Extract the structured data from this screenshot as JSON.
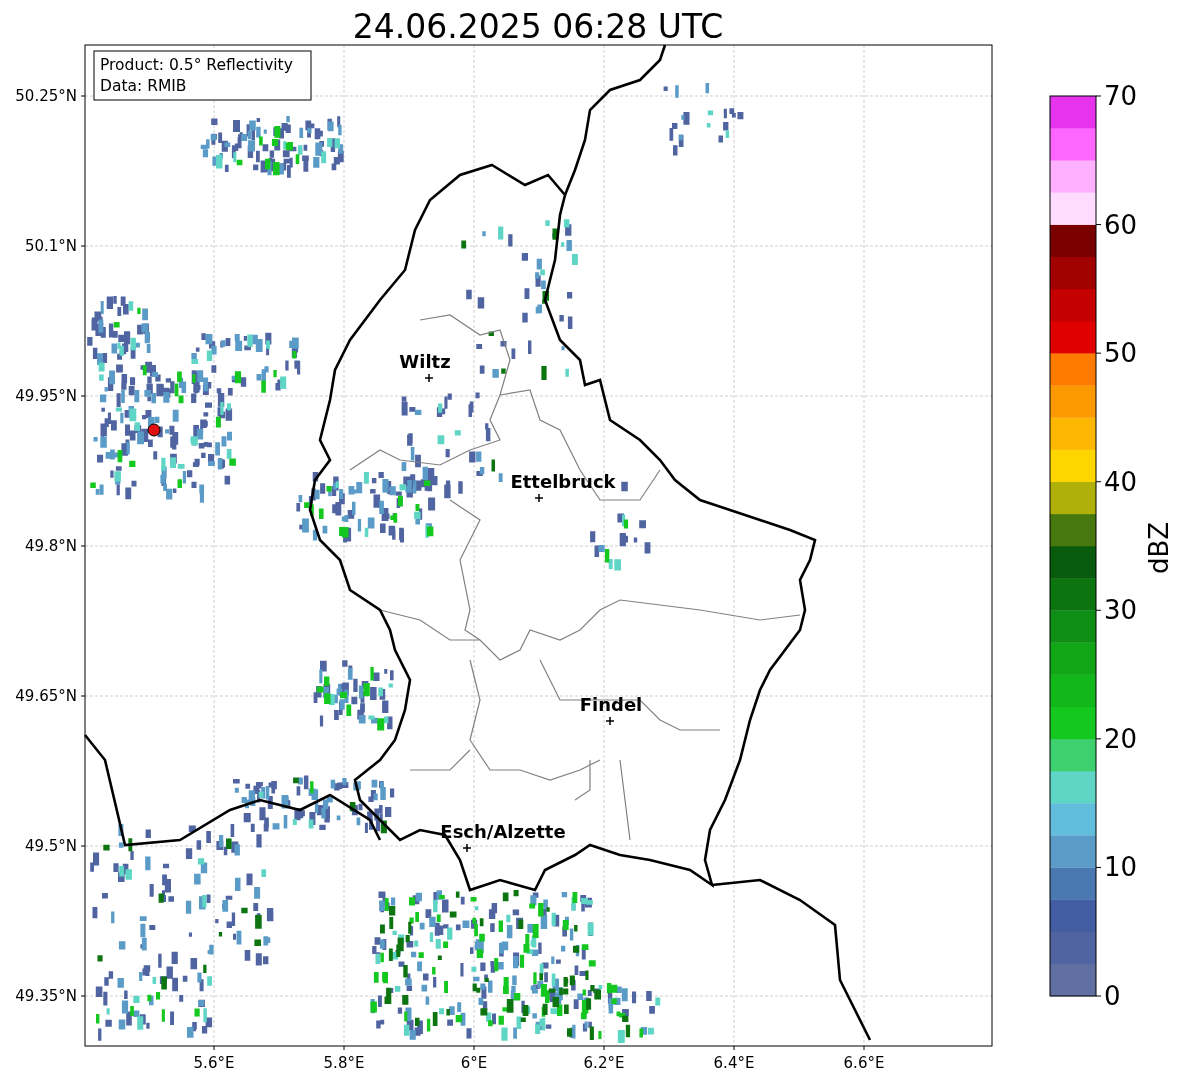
{
  "title": "24.06.2025 06:28 UTC",
  "info_box": {
    "lines": [
      "Product: 0.5° Reflectivity",
      "Data: RMIB"
    ]
  },
  "map": {
    "x_ticks": [
      "5.6°E",
      "5.8°E",
      "6°E",
      "6.2°E",
      "6.4°E",
      "6.6°E"
    ],
    "y_ticks": [
      "50.25°N",
      "50.1°N",
      "49.95°N",
      "49.8°N",
      "49.65°N",
      "49.5°N",
      "49.35°N"
    ],
    "cities": [
      {
        "name": "Wiltz"
      },
      {
        "name": "Ettelbruck"
      },
      {
        "name": "Findel"
      },
      {
        "name": "Esch/Alzette"
      }
    ]
  },
  "colorbar": {
    "label": "dBZ",
    "ticks": [
      "70",
      "60",
      "50",
      "40",
      "30",
      "20",
      "10",
      "0"
    ],
    "bins": [
      {
        "color": "#6070a2"
      },
      {
        "color": "#4f64a0"
      },
      {
        "color": "#435da3"
      },
      {
        "color": "#4a78b0"
      },
      {
        "color": "#5a9bc7"
      },
      {
        "color": "#62bcdc"
      },
      {
        "color": "#5fd5c5"
      },
      {
        "color": "#3ed06e"
      },
      {
        "color": "#15c81f"
      },
      {
        "color": "#12b81a"
      },
      {
        "color": "#10a615"
      },
      {
        "color": "#0e8e14"
      },
      {
        "color": "#0c7510"
      },
      {
        "color": "#085a0c"
      },
      {
        "color": "#47770f"
      },
      {
        "color": "#b0b00a"
      },
      {
        "color": "#ffd500"
      },
      {
        "color": "#fdb700"
      },
      {
        "color": "#fd9900"
      },
      {
        "color": "#ff7b00"
      },
      {
        "color": "#e00000"
      },
      {
        "color": "#c40000"
      },
      {
        "color": "#a00000"
      },
      {
        "color": "#7a0000"
      },
      {
        "color": "#ffdcff"
      },
      {
        "color": "#ffb0ff"
      },
      {
        "color": "#ff66ff"
      },
      {
        "color": "#e633ee"
      }
    ]
  }
}
